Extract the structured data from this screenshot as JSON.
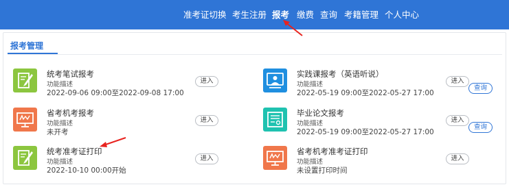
{
  "nav": {
    "items": [
      {
        "label": "准考证切换"
      },
      {
        "label": "考生注册"
      },
      {
        "label": "报考"
      },
      {
        "label": "缴费"
      },
      {
        "label": "查询"
      },
      {
        "label": "考籍管理"
      },
      {
        "label": "个人中心"
      }
    ],
    "active": "报考"
  },
  "tab": {
    "label": "报考管理"
  },
  "items": [
    {
      "title": "统考笔试报考",
      "desc": "功能描述",
      "time": "2022-09-06 09:00至2022-09-08 17:00",
      "enter": "进入",
      "icon": "pen-paper-icon",
      "color": "#8cc63f"
    },
    {
      "title": "实践课报考（英语听说）",
      "desc": "功能描述",
      "time": "2022-05-19 09:00至2022-05-27 17:00",
      "enter": "进入",
      "query": "查询",
      "icon": "presenter-screen-icon",
      "color": "#1f8fe0"
    },
    {
      "title": "省考机考报考",
      "desc": "功能描述",
      "time": "未开考",
      "enter": "进入",
      "icon": "computer-monitor-icon",
      "color": "#f0774b"
    },
    {
      "title": "毕业论文报考",
      "desc": "功能描述",
      "time": "2022-05-19 09:00至2022-05-27 17:00",
      "enter": "进入",
      "query": "查询",
      "icon": "certificate-icon",
      "color": "#1fc2b0"
    },
    {
      "title": "统考准考证打印",
      "desc": "功能描述",
      "time": "2022-10-10 00:00开始",
      "enter": "进入",
      "icon": "pen-paper-icon",
      "color": "#8cc63f"
    },
    {
      "title": "省考机考准考证打印",
      "desc": "功能描述",
      "time": "未设置打印时间",
      "enter": "进入",
      "icon": "computer-monitor-icon",
      "color": "#f0774b"
    }
  ],
  "colors": {
    "primary": "#2f75d6",
    "annotation_arrow": "#e8231f"
  }
}
